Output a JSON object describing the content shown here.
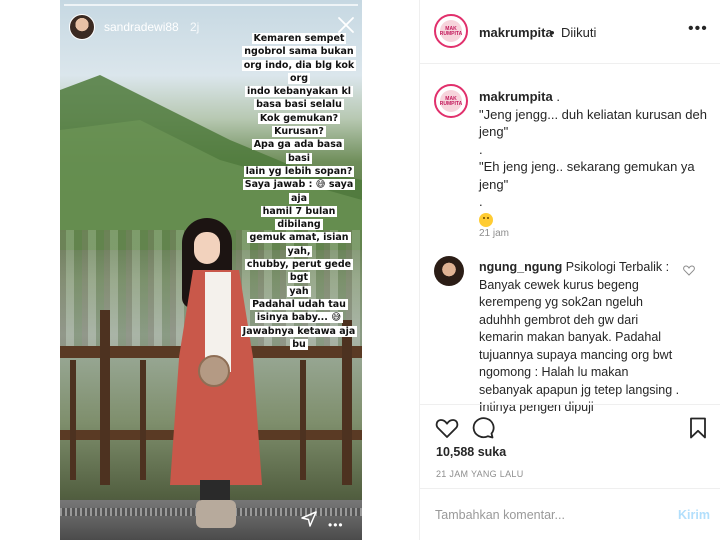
{
  "story": {
    "username": "sandradewi88",
    "time": "2j",
    "caption_lines": [
      "Kemaren sempet",
      "ngobrol sama bukan",
      "org indo, dia blg kok org",
      "indo kebanyakan kl",
      "basa basi selalu",
      "Kok gemukan?",
      "Kurusan?",
      "Apa ga ada basa basi",
      "lain yg lebih sopan?",
      "Saya jawab : 😅 saya aja",
      "hamil 7 bulan dibilang",
      "gemuk amat, isian yah,",
      "chubby, perut gede bgt",
      "yah",
      "Padahal udah tau",
      "isinya baby... 😅",
      "Jawabnya ketawa aja",
      "bu"
    ],
    "more_label": "•••"
  },
  "header": {
    "username": "makrumpita",
    "dot": "•",
    "follow_status": "Diikuti",
    "more_label": "•••"
  },
  "caption": {
    "username": "makrumpita",
    "text_lines": [
      " .",
      "\"Jeng jengg... duh keliatan kurusan deh jeng\"",
      ".",
      "\"Eh jeng jeng.. sekarang gemukan ya jeng\"",
      "."
    ],
    "time": "21 jam"
  },
  "comment": {
    "username": "ngung_ngung",
    "text": " Psikologi Terbalik : Banyak cewek kurus begeng kerempeng yg sok2an ngeluh aduhhh gembrot deh gw dari kemarin makan banyak. Padahal tujuannya supaya mancing org bwt ngomong : Halah lu makan sebanyak apapun jg tetep langsing . Intinya pengen dipuji"
  },
  "likes": "10,588 suka",
  "post_time": "21 JAM YANG LALU",
  "add_comment": {
    "placeholder": "Tambahkan komentar...",
    "post_label": "Kirim"
  },
  "brand_avatar_text": "MAK RUMPITA"
}
